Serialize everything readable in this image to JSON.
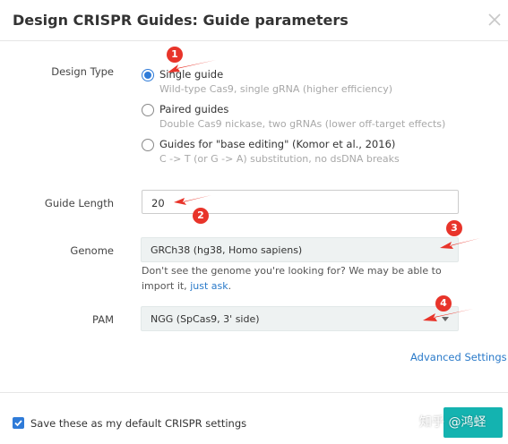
{
  "dialog": {
    "title": "Design CRISPR Guides: Guide parameters"
  },
  "design_type": {
    "label": "Design Type",
    "options": [
      {
        "label": "Single guide",
        "description": "Wild-type Cas9, single gRNA (higher efficiency)",
        "selected": true
      },
      {
        "label": "Paired guides",
        "description": "Double Cas9 nickase, two gRNAs (lower off-target effects)",
        "selected": false
      },
      {
        "label": "Guides for \"base editing\" (Komor et al., 2016)",
        "description": "C -> T (or G -> A) substitution, no dsDNA breaks",
        "selected": false
      }
    ]
  },
  "guide_length": {
    "label": "Guide Length",
    "value": "20"
  },
  "genome": {
    "label": "Genome",
    "value": "GRCh38 (hg38, Homo sapiens)",
    "help_text": "Don't see the genome you're looking for? We may be able to import it,",
    "help_link": "just ask",
    "help_end": "."
  },
  "pam": {
    "label": "PAM",
    "value": "NGG (SpCas9, 3' side)"
  },
  "advanced_settings": "Advanced Settings",
  "footer": {
    "checkbox_label": "Save these as my default CRISPR settings",
    "checkbox_checked": true
  },
  "annotations": [
    "1",
    "2",
    "3",
    "4"
  ],
  "watermark": "知乎 @鸿蛏",
  "colors": {
    "accent": "#2f7bd8",
    "link": "#2a7ac9",
    "annotation": "#e8342a",
    "button": "#14b3b0"
  }
}
